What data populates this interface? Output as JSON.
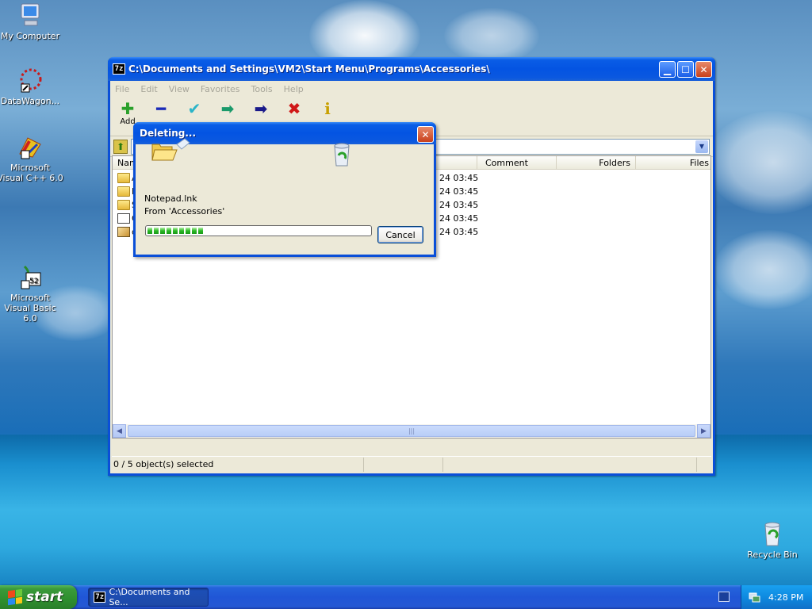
{
  "desktop": {
    "icons": [
      {
        "label": "My Computer",
        "icon": "my-computer-icon"
      },
      {
        "label": "DataWagon...",
        "icon": "datawagon-icon"
      },
      {
        "label": "Microsoft Visual C++ 6.0",
        "icon": "visual-cpp-icon"
      },
      {
        "label": "Microsoft Visual Basic 6.0",
        "icon": "visual-basic-icon"
      },
      {
        "label": "Recycle Bin",
        "icon": "recycle-bin-icon"
      }
    ]
  },
  "window": {
    "title": "C:\\Documents and Settings\\VM2\\Start Menu\\Programs\\Accessories\\",
    "app_icon_text": "7z",
    "menu": [
      "File",
      "Edit",
      "View",
      "Favorites",
      "Tools",
      "Help"
    ],
    "toolbar": [
      {
        "label": "Add",
        "icon": "add-icon",
        "color": "#2aa02a"
      },
      {
        "label": "",
        "icon": "extract-icon",
        "color": "#1a2ab8"
      },
      {
        "label": "",
        "icon": "test-icon",
        "color": "#2ab4c8"
      },
      {
        "label": "",
        "icon": "copy-icon",
        "color": "#1a9a6a"
      },
      {
        "label": "",
        "icon": "move-icon",
        "color": "#1a1a8a"
      },
      {
        "label": "",
        "icon": "delete-icon",
        "color": "#d01818"
      },
      {
        "label": "",
        "icon": "info-icon",
        "color": "#c8a000"
      }
    ],
    "columns": [
      "Nam",
      "Comment",
      "Folders",
      "Files"
    ],
    "rows": [
      {
        "name": "A",
        "date": "24 03:45",
        "type": "folder"
      },
      {
        "name": "E",
        "date": "24 03:45",
        "type": "folder"
      },
      {
        "name": "S",
        "date": "24 03:45",
        "type": "folder"
      },
      {
        "name": "C",
        "date": "24 03:45",
        "type": "file"
      },
      {
        "name": "d",
        "date": "24 03:45",
        "type": "shortcut"
      }
    ],
    "status": "0 / 5 object(s) selected"
  },
  "dialog": {
    "title": "Deleting...",
    "file": "Notepad.lnk",
    "from": "From 'Accessories'",
    "progress_blocks": 9,
    "cancel_label": "Cancel"
  },
  "taskbar": {
    "start_label": "start",
    "task_icon_text": "7z",
    "task_label": "C:\\Documents and Se...",
    "clock": "4:28 PM"
  }
}
